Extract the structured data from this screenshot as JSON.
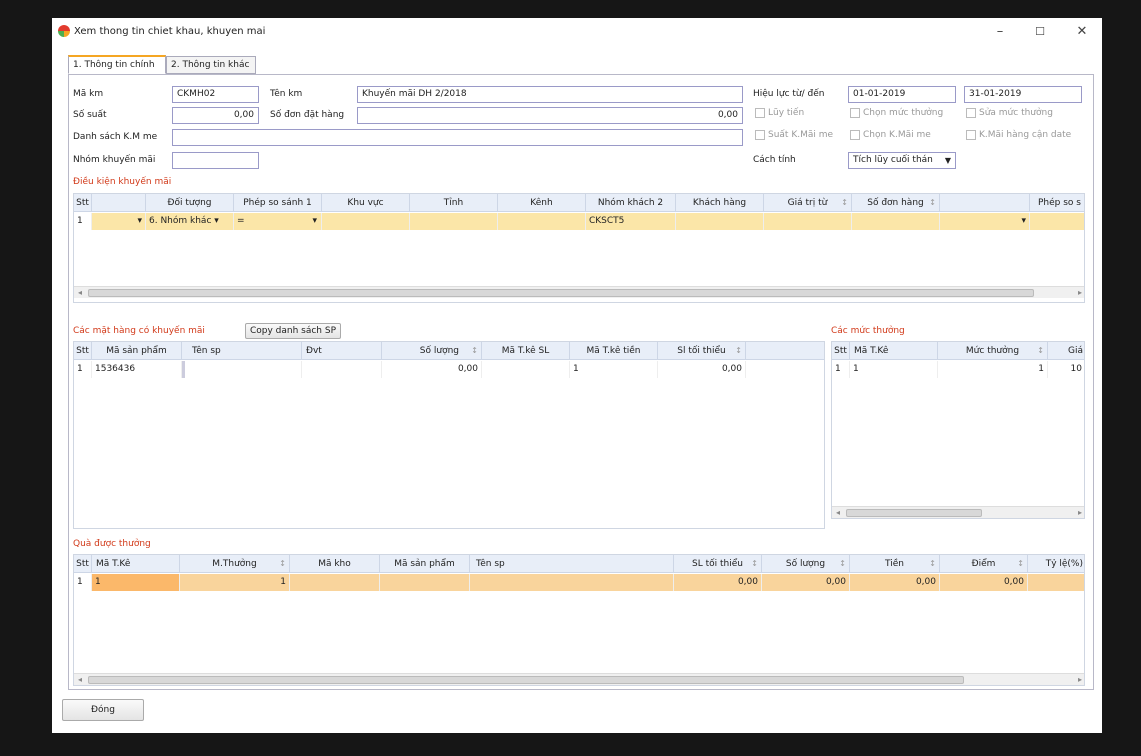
{
  "window": {
    "title": "Xem thong tin chiet khau, khuyen mai",
    "min": "–",
    "max": "☐",
    "close": "✕"
  },
  "tabs": [
    "1. Thông tin chính",
    "2. Thông tin khác"
  ],
  "form": {
    "ma_km_label": "Mã km",
    "ma_km": "CKMH02",
    "ten_km_label": "Tên km",
    "ten_km": "Khuyến mãi DH 2/2018",
    "hieu_luc_label": "Hiệu lực từ/ đến",
    "from": "01-01-2019",
    "to": "31-01-2019",
    "so_suat_label": "Số suất",
    "so_suat": "0,00",
    "so_don_label": "Số đơn đặt hàng",
    "so_don": "0,00",
    "luy_tien": "Lũy tiến",
    "chon_muc_thuong": "Chọn mức thưởng",
    "sua_muc_thuong": "Sửa mức thưởng",
    "suat_kmai_me": "Suất K.Mãi me",
    "chon_kmai_me": "Chọn K.Mãi me",
    "kmai_hang_can_date": "K.Mãi hàng cận date",
    "danh_sach_label": "Danh sách K.M me",
    "nhom_km_label": "Nhóm khuyến mãi",
    "cach_tinh_label": "Cách tính",
    "cach_tinh": "Tích lũy cuối thán"
  },
  "dieu_kien": {
    "title": "Điều kiện khuyến mãi",
    "headers": [
      "Stt",
      "",
      "Đối tượng",
      "Phép so sánh 1",
      "Khu vực",
      "Tỉnh",
      "Kênh",
      "Nhóm khách 2",
      "Khách hàng",
      "Giá trị từ",
      "Số đơn hàng",
      "",
      "Phép so s"
    ],
    "row": {
      "stt": "1",
      "doi_tuong": "6. Nhóm khác",
      "phep_so": "=",
      "nhom_khach": "CKSCT5"
    }
  },
  "mat_hang": {
    "title": "Các mặt hàng có khuyến mãi",
    "copy_button": "Copy danh sách SP",
    "headers": [
      "Stt",
      "Mã sản phẩm",
      "Tên sp",
      "Đvt",
      "Số lượng",
      "Mã T.kê SL",
      "Mã T.kê tiền",
      "Sl tối thiểu"
    ],
    "row": {
      "stt": "1",
      "ma_sp": "1536436",
      "so_luong": "0,00",
      "ma_tke_tien": "1",
      "sl_toi_thieu": "0,00"
    }
  },
  "muc_thuong": {
    "title": "Các mức thưởng",
    "headers": [
      "Stt",
      "Mã T.Kê",
      "Mức thưởng",
      "Giá"
    ],
    "row": {
      "stt": "1",
      "ma_tke": "1",
      "muc": "1",
      "gia": "10"
    }
  },
  "qua": {
    "title": "Quà được thưởng",
    "headers": [
      "Stt",
      "Mã T.Kê",
      "M.Thưởng",
      "Mã kho",
      "Mã sản phẩm",
      "Tên sp",
      "SL tối thiểu",
      "Số lượng",
      "Tiền",
      "Điểm",
      "Tỷ lệ(%)"
    ],
    "row": {
      "stt": "1",
      "ma_tke": "1",
      "m_thuong": "1",
      "sl_toi_thieu": "0,00",
      "so_luong": "0,00",
      "tien": "0,00",
      "diem": "0,00"
    }
  },
  "close_button": "Đóng",
  "colors": {
    "selected_row": "#fbe6a8",
    "orange_row": "#f9d49c",
    "header_bg": "#e8eef8",
    "red_label": "#d23a1a"
  }
}
